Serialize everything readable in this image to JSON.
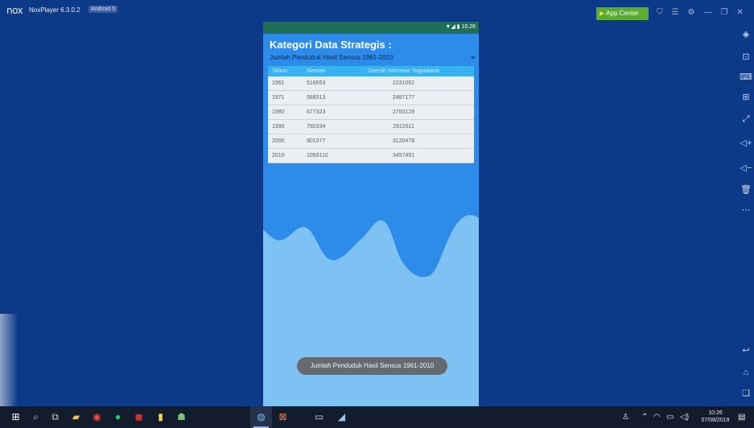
{
  "nox": {
    "logo": "nox",
    "title": "NoxPlayer 6.3.0.2",
    "badge": "Android 5",
    "app_center": "App Center",
    "titlebar_icons": [
      "shirt-icon",
      "menu-icon",
      "settings-icon",
      "minimize-icon",
      "restore-icon",
      "close-icon"
    ],
    "right_toolbar_icons": [
      "sidebar-toggle-icon",
      "screenshot-icon",
      "keyboard-icon",
      "add-apk-icon",
      "fullscreen-icon",
      "volume-up-icon",
      "volume-down-icon",
      "trash-icon",
      "more-icon",
      "back-icon",
      "home-icon",
      "recents-icon"
    ]
  },
  "phone": {
    "status": {
      "time": "10.26",
      "icons": "wifi-icon signal-icon battery-icon"
    },
    "app_title": "Kategori Data Strategis  :",
    "spinner_selected": "Jumlah Penduduk Hasil Sensus 1961-2010",
    "table": {
      "headers": [
        "Tahun",
        "Sleman",
        "Daerah Istimewa Yogyakarta"
      ],
      "rows": [
        [
          "1961",
          "516653",
          "2231062"
        ],
        [
          "1971",
          "588313",
          "2487177"
        ],
        [
          "1980",
          "677323",
          "2760128"
        ],
        [
          "1990",
          "780334",
          "2912611"
        ],
        [
          "2000",
          "901377",
          "3120478"
        ],
        [
          "2010",
          "1093110",
          "3457491"
        ]
      ]
    },
    "toast": "Jumlah Penduduk Hasil Sensus  1961-2010"
  },
  "taskbar": {
    "apps": [
      "windows-start-icon",
      "search-icon",
      "task-view-icon",
      "file-explorer-icon",
      "chrome-icon",
      "spotify-icon",
      "filezilla-icon",
      "sticky-notes-icon",
      "android-studio-icon",
      "nox-icon",
      "xampp-icon",
      "terminal-icon",
      "app-icon"
    ],
    "clock_time": "10:26",
    "clock_date": "07/08/2019",
    "tray_icons": [
      "people-icon",
      "chevron-up-icon",
      "wifi-icon",
      "battery-icon",
      "speaker-icon",
      "notification-icon"
    ]
  },
  "colors": {
    "desktop_bg": "#0c3a88",
    "app_bar": "#2d8be9",
    "table_header": "#35b2ef",
    "wave": "#7ec2f4",
    "status_bar": "#1f6f55"
  }
}
